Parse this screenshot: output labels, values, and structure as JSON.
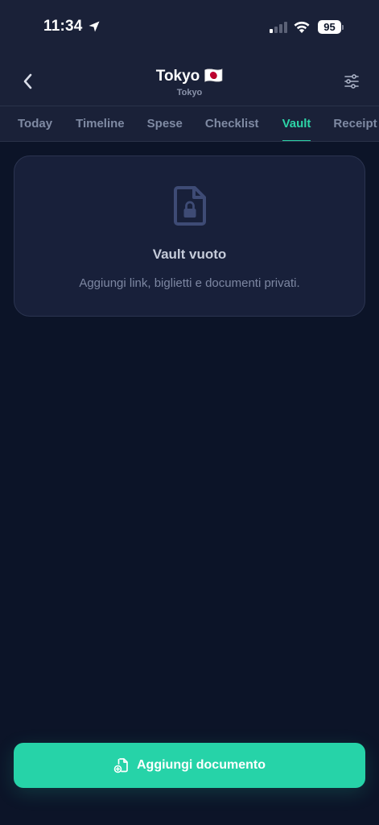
{
  "status_bar": {
    "time": "11:34",
    "battery": "95",
    "icons": [
      "location-arrow-icon",
      "cellular-signal-icon",
      "wifi-icon",
      "battery-icon"
    ]
  },
  "header": {
    "title": "Tokyo 🇯🇵",
    "subtitle": "Tokyo",
    "back_icon": "chevron-left-icon",
    "filter_icon": "sliders-icon"
  },
  "tabs": [
    {
      "label": "Today",
      "active": false
    },
    {
      "label": "Timeline",
      "active": false
    },
    {
      "label": "Spese",
      "active": false
    },
    {
      "label": "Checklist",
      "active": false
    },
    {
      "label": "Vault",
      "active": true
    },
    {
      "label": "Receipt",
      "active": false
    }
  ],
  "empty_state": {
    "icon": "locked-document-icon",
    "title": "Vault vuoto",
    "description": "Aggiungi link, biglietti e documenti privati."
  },
  "action": {
    "label": "Aggiungi documento",
    "icon": "add-document-icon"
  },
  "colors": {
    "background": "#0c1428",
    "header_background": "#1a2138",
    "accent": "#26d3a8",
    "active_tab": "#2dd4a7",
    "card": "#18203a"
  }
}
